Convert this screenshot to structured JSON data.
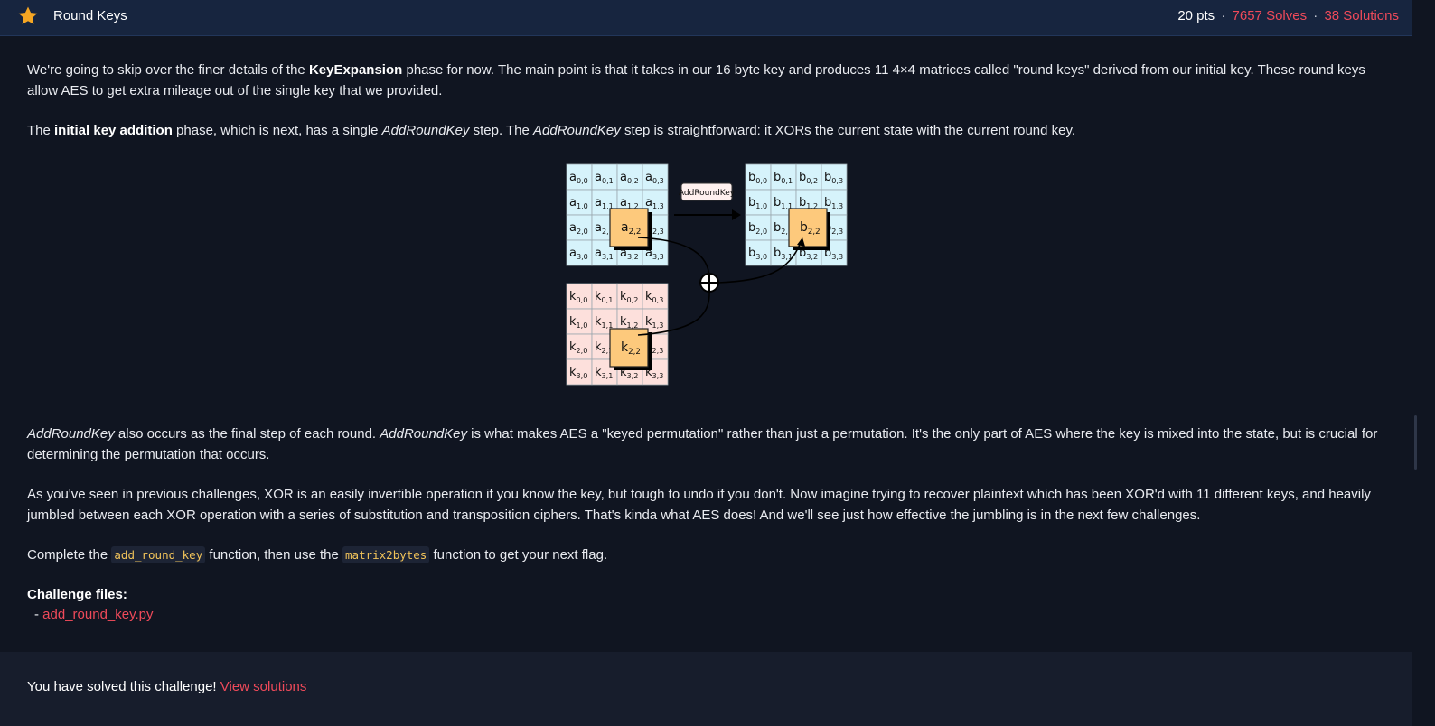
{
  "header": {
    "title": "Round Keys",
    "points": "20 pts",
    "separator": "·",
    "solves": "7657 Solves",
    "solutions": "38 Solutions",
    "accent_color": "#ef4a5a",
    "star_color": "#f5a623"
  },
  "body": {
    "p1": {
      "t1": "We're going to skip over the finer details of the ",
      "b1": "KeyExpansion",
      "t2": " phase for now. The main point is that it takes in our 16 byte key and produces 11 4×4 matrices called \"round keys\" derived from our initial key. These round keys allow AES to get extra mileage out of the single key that we provided."
    },
    "p2": {
      "t1": "The ",
      "b1": "initial key addition",
      "t2": " phase, which is next, has a single ",
      "i1": "AddRoundKey",
      "t3": " step. The ",
      "i2": "AddRoundKey",
      "t4": " step is straightforward: it XORs the current state with the current round key."
    },
    "p3": {
      "i1": "AddRoundKey",
      "t1": " also occurs as the final step of each round. ",
      "i2": "AddRoundKey",
      "t2": " is what makes AES a \"keyed permutation\" rather than just a permutation. It's the only part of AES where the key is mixed into the state, but is crucial for determining the permutation that occurs."
    },
    "p4": {
      "t1": "As you've seen in previous challenges, XOR is an easily invertible operation if you know the key, but tough to undo if you don't. Now imagine trying to recover plaintext which has been XOR'd with 11 different keys, and heavily jumbled between each XOR operation with a series of substitution and transposition ciphers. That's kinda what AES does! And we'll see just how effective the jumbling is in the next few challenges."
    },
    "p5": {
      "t1": "Complete the ",
      "c1": "add_round_key",
      "t2": " function, then use the ",
      "c2": "matrix2bytes",
      "t3": " function to get your next flag."
    },
    "files_heading": "Challenge files:",
    "file_dash": "- ",
    "file_link": "add_round_key.py"
  },
  "diagram": {
    "label": "AddRoundKey",
    "state_letter": "a",
    "output_letter": "b",
    "key_letter": "k",
    "highlight_index": "2,2",
    "state_color": "#d6f3fb",
    "key_color": "#fde0dc",
    "highlight_color": "#fdc97c"
  },
  "footer": {
    "message": "You have solved this challenge! ",
    "link": "View solutions"
  }
}
